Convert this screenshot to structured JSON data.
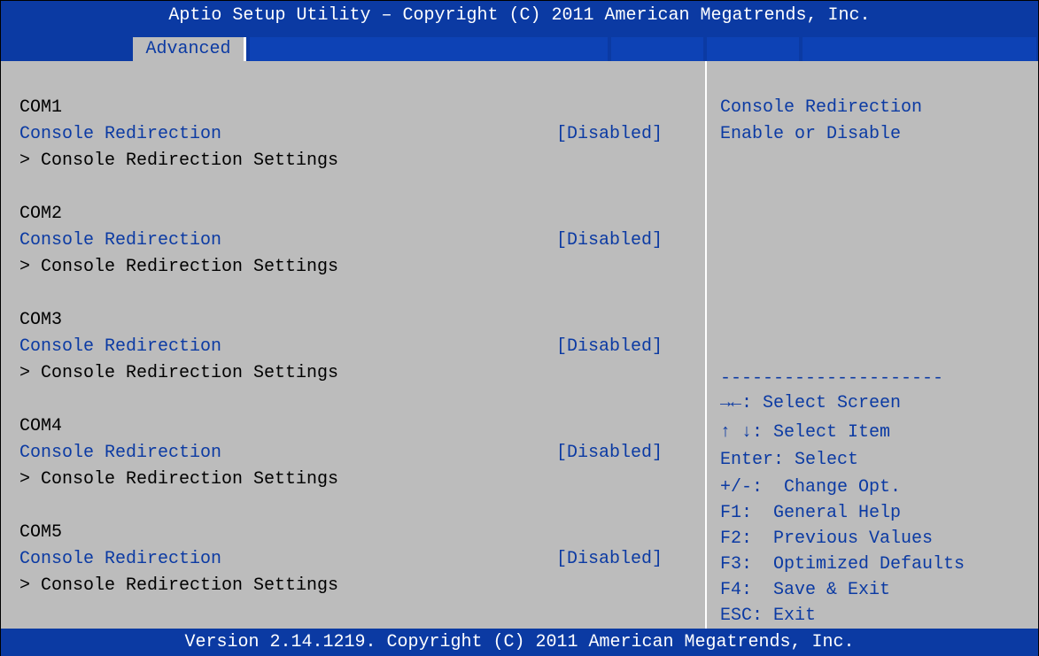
{
  "title": "Aptio Setup Utility – Copyright (C) 2011 American Megatrends, Inc.",
  "tabs": {
    "active": "Advanced"
  },
  "ports": [
    {
      "label": "COM1",
      "setting": "Console Redirection",
      "value": "[Disabled]",
      "submenu": "> Console Redirection Settings"
    },
    {
      "label": "COM2",
      "setting": "Console Redirection",
      "value": "[Disabled]",
      "submenu": "> Console Redirection Settings"
    },
    {
      "label": "COM3",
      "setting": "Console Redirection",
      "value": "[Disabled]",
      "submenu": "> Console Redirection Settings"
    },
    {
      "label": "COM4",
      "setting": "Console Redirection",
      "value": "[Disabled]",
      "submenu": "> Console Redirection Settings"
    },
    {
      "label": "COM5",
      "setting": "Console Redirection",
      "value": "[Disabled]",
      "submenu": "> Console Redirection Settings"
    }
  ],
  "help": {
    "line1": "Console Redirection",
    "line2": "Enable or Disable",
    "separator": "---------------------",
    "keys": [
      "→←: Select Screen",
      "↑ ↓: Select Item",
      "Enter: Select",
      "+/-:  Change Opt.",
      "F1:  General Help",
      "F2:  Previous Values",
      "F3:  Optimized Defaults",
      "F4:  Save & Exit",
      "ESC: Exit"
    ]
  },
  "footer": "Version 2.14.1219. Copyright (C) 2011 American Megatrends, Inc.",
  "colors": {
    "bios_blue": "#0b3aa3",
    "panel_gray": "#bcbcbc",
    "text_black": "#000000",
    "text_white": "#ffffff"
  }
}
